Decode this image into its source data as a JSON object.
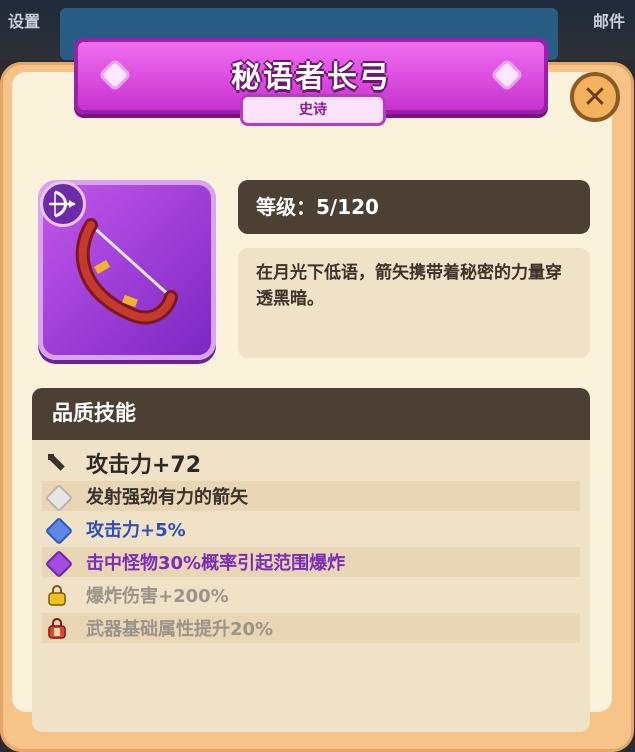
{
  "background": {
    "left_text": "设置",
    "right_text": "邮件"
  },
  "item": {
    "name": "秘语者长弓",
    "rarity": "史诗",
    "level_text": "等级：5/120",
    "description": "在月光下低语，箭矢携带着秘密的力量穿透黑暗。"
  },
  "skills": {
    "header": "品质技能",
    "rows": [
      {
        "icon": "sword-icon",
        "text": "攻击力+72",
        "color": "#2e2924"
      },
      {
        "icon": "white-diamond-icon",
        "text": "发射强劲有力的箭矢",
        "color": "#3a332c"
      },
      {
        "icon": "blue-diamond-icon",
        "text": "攻击力+5%",
        "color": "#2f4fb5"
      },
      {
        "icon": "purple-diamond-icon",
        "text": "击中怪物30%概率引起范围爆炸",
        "color": "#7b2cb8"
      },
      {
        "icon": "gold-lock-icon",
        "text": "爆炸伤害+200%",
        "color": "#9b948a"
      },
      {
        "icon": "red-lock-icon",
        "text": "武器基础属性提升20%",
        "color": "#9b948a"
      }
    ]
  },
  "colors": {
    "accent": "#d13fd6",
    "panel": "#f6c489",
    "dark": "#4c3f33"
  }
}
